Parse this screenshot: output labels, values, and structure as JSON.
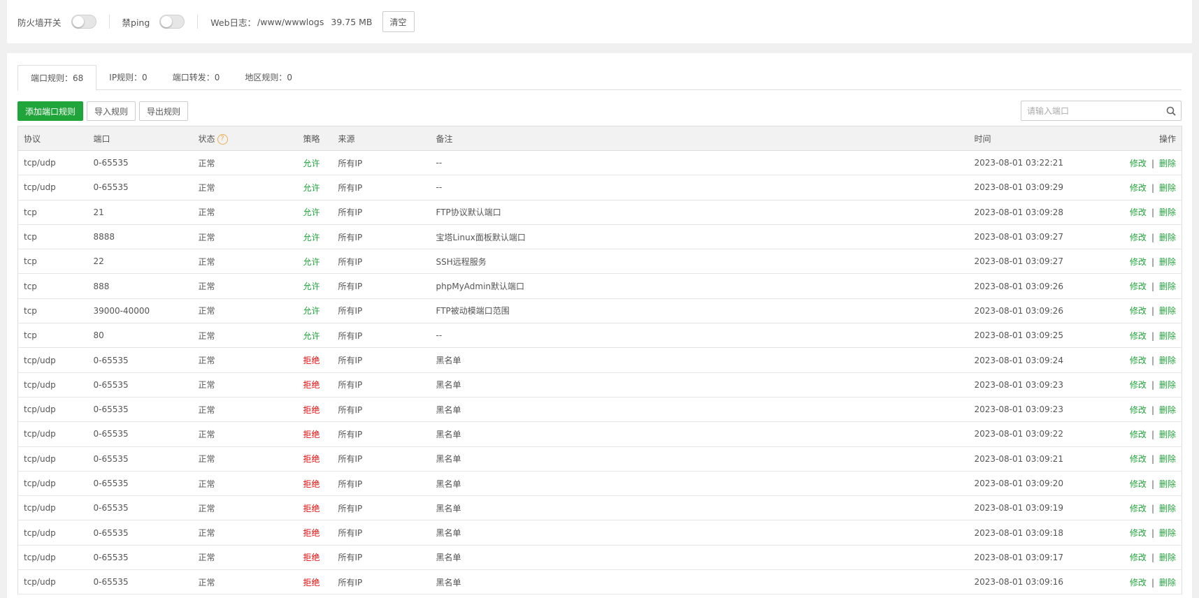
{
  "topbar": {
    "firewall_label": "防火墙开关",
    "ping_label": "禁ping",
    "weblog_label": "Web日志：",
    "weblog_path": "/www/wwwlogs",
    "weblog_size": "39.75 MB",
    "clear_label": "清空"
  },
  "tabs": [
    {
      "label": "端口规则：68",
      "active": true
    },
    {
      "label": "IP规则：0",
      "active": false
    },
    {
      "label": "端口转发：0",
      "active": false
    },
    {
      "label": "地区规则：0",
      "active": false
    }
  ],
  "toolbar": {
    "add_label": "添加端口规则",
    "import_label": "导入规则",
    "export_label": "导出规则",
    "search_placeholder": "请输入端口"
  },
  "table": {
    "headers": {
      "protocol": "协议",
      "port": "端口",
      "status": "状态",
      "policy": "策略",
      "source": "来源",
      "remark": "备注",
      "time": "时间",
      "action": "操作"
    },
    "edit_label": "修改",
    "delete_label": "删除",
    "op_sep": "|",
    "rows": [
      {
        "protocol": "tcp/udp",
        "port": "0-65535",
        "status": "正常",
        "policy": "允许",
        "policy_type": "allow",
        "source": "所有IP",
        "remark": "--",
        "time": "2023-08-01 03:22:21"
      },
      {
        "protocol": "tcp/udp",
        "port": "0-65535",
        "status": "正常",
        "policy": "允许",
        "policy_type": "allow",
        "source": "所有IP",
        "remark": "--",
        "time": "2023-08-01 03:09:29"
      },
      {
        "protocol": "tcp",
        "port": "21",
        "status": "正常",
        "policy": "允许",
        "policy_type": "allow",
        "source": "所有IP",
        "remark": "FTP协议默认端口",
        "time": "2023-08-01 03:09:28"
      },
      {
        "protocol": "tcp",
        "port": "8888",
        "status": "正常",
        "policy": "允许",
        "policy_type": "allow",
        "source": "所有IP",
        "remark": "宝塔Linux面板默认端口",
        "time": "2023-08-01 03:09:27"
      },
      {
        "protocol": "tcp",
        "port": "22",
        "status": "正常",
        "policy": "允许",
        "policy_type": "allow",
        "source": "所有IP",
        "remark": "SSH远程服务",
        "time": "2023-08-01 03:09:27"
      },
      {
        "protocol": "tcp",
        "port": "888",
        "status": "正常",
        "policy": "允许",
        "policy_type": "allow",
        "source": "所有IP",
        "remark": "phpMyAdmin默认端口",
        "time": "2023-08-01 03:09:26"
      },
      {
        "protocol": "tcp",
        "port": "39000-40000",
        "status": "正常",
        "policy": "允许",
        "policy_type": "allow",
        "source": "所有IP",
        "remark": "FTP被动模端口范围",
        "time": "2023-08-01 03:09:26"
      },
      {
        "protocol": "tcp",
        "port": "80",
        "status": "正常",
        "policy": "允许",
        "policy_type": "allow",
        "source": "所有IP",
        "remark": "--",
        "time": "2023-08-01 03:09:25"
      },
      {
        "protocol": "tcp/udp",
        "port": "0-65535",
        "status": "正常",
        "policy": "拒绝",
        "policy_type": "deny",
        "source": "所有IP",
        "remark": "黑名单",
        "time": "2023-08-01 03:09:24"
      },
      {
        "protocol": "tcp/udp",
        "port": "0-65535",
        "status": "正常",
        "policy": "拒绝",
        "policy_type": "deny",
        "source": "所有IP",
        "remark": "黑名单",
        "time": "2023-08-01 03:09:23"
      },
      {
        "protocol": "tcp/udp",
        "port": "0-65535",
        "status": "正常",
        "policy": "拒绝",
        "policy_type": "deny",
        "source": "所有IP",
        "remark": "黑名单",
        "time": "2023-08-01 03:09:23"
      },
      {
        "protocol": "tcp/udp",
        "port": "0-65535",
        "status": "正常",
        "policy": "拒绝",
        "policy_type": "deny",
        "source": "所有IP",
        "remark": "黑名单",
        "time": "2023-08-01 03:09:22"
      },
      {
        "protocol": "tcp/udp",
        "port": "0-65535",
        "status": "正常",
        "policy": "拒绝",
        "policy_type": "deny",
        "source": "所有IP",
        "remark": "黑名单",
        "time": "2023-08-01 03:09:21"
      },
      {
        "protocol": "tcp/udp",
        "port": "0-65535",
        "status": "正常",
        "policy": "拒绝",
        "policy_type": "deny",
        "source": "所有IP",
        "remark": "黑名单",
        "time": "2023-08-01 03:09:20"
      },
      {
        "protocol": "tcp/udp",
        "port": "0-65535",
        "status": "正常",
        "policy": "拒绝",
        "policy_type": "deny",
        "source": "所有IP",
        "remark": "黑名单",
        "time": "2023-08-01 03:09:19"
      },
      {
        "protocol": "tcp/udp",
        "port": "0-65535",
        "status": "正常",
        "policy": "拒绝",
        "policy_type": "deny",
        "source": "所有IP",
        "remark": "黑名单",
        "time": "2023-08-01 03:09:18"
      },
      {
        "protocol": "tcp/udp",
        "port": "0-65535",
        "status": "正常",
        "policy": "拒绝",
        "policy_type": "deny",
        "source": "所有IP",
        "remark": "黑名单",
        "time": "2023-08-01 03:09:17"
      },
      {
        "protocol": "tcp/udp",
        "port": "0-65535",
        "status": "正常",
        "policy": "拒绝",
        "policy_type": "deny",
        "source": "所有IP",
        "remark": "黑名单",
        "time": "2023-08-01 03:09:16"
      }
    ]
  },
  "colors": {
    "accent": "#20a53a",
    "deny": "#ef0808",
    "help_icon": "#f0ad4e"
  },
  "icons": {
    "search": "search-icon",
    "help": "question-circle-icon"
  }
}
